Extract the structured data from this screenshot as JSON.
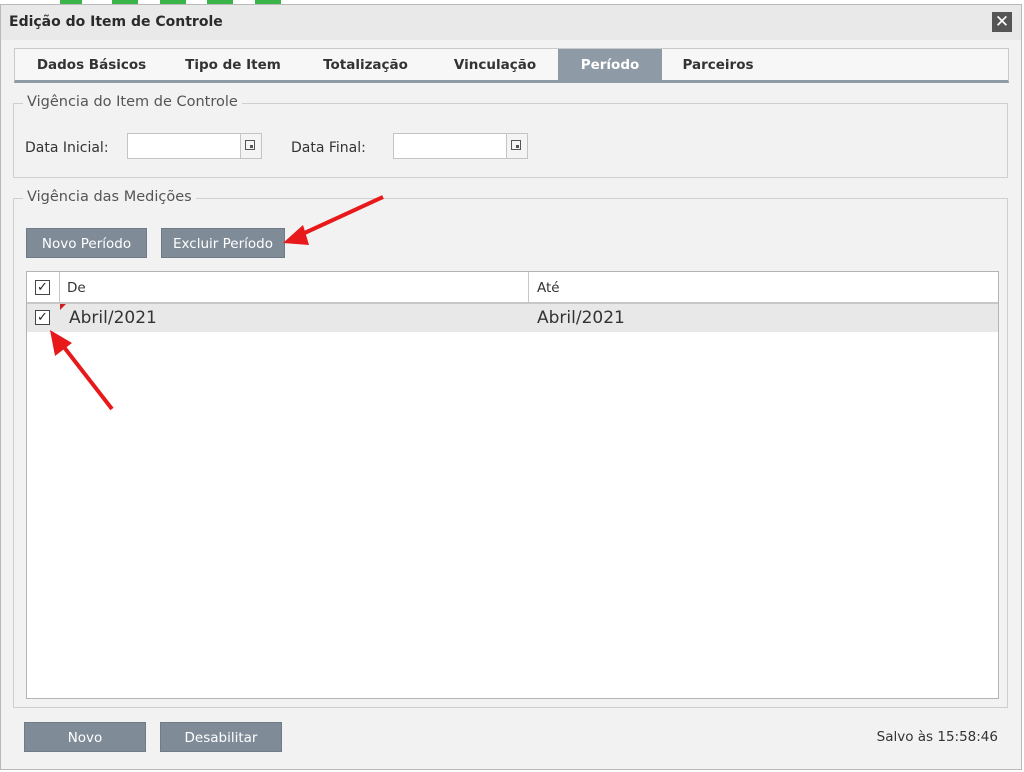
{
  "dialog": {
    "title": "Edição do Item de Controle",
    "close_glyph": "✕"
  },
  "tabs": [
    {
      "label": "Dados Básicos",
      "active": false
    },
    {
      "label": "Tipo de Item",
      "active": false
    },
    {
      "label": "Totalização",
      "active": false
    },
    {
      "label": "Vinculação",
      "active": false
    },
    {
      "label": "Período",
      "active": true
    },
    {
      "label": "Parceiros",
      "active": false
    }
  ],
  "vigencia_item": {
    "legend": "Vigência do Item de Controle",
    "data_inicial_label": "Data Inicial:",
    "data_inicial_value": "",
    "data_final_label": "Data Final:",
    "data_final_value": ""
  },
  "vigencia_medicoes": {
    "legend": "Vigência das Medições",
    "novo_periodo": "Novo Período",
    "excluir_periodo": "Excluir Período",
    "columns": {
      "de": "De",
      "ate": "Até"
    },
    "rows": [
      {
        "checked": true,
        "de": "Abril/2021",
        "ate": "Abril/2021"
      }
    ]
  },
  "footer": {
    "novo": "Novo",
    "desabilitar": "Desabilitar",
    "status": "Salvo às 15:58:46"
  },
  "colors": {
    "accent": "#8e9aa5",
    "button": "#7f8c98",
    "annotation_arrow": "#e8191b"
  }
}
